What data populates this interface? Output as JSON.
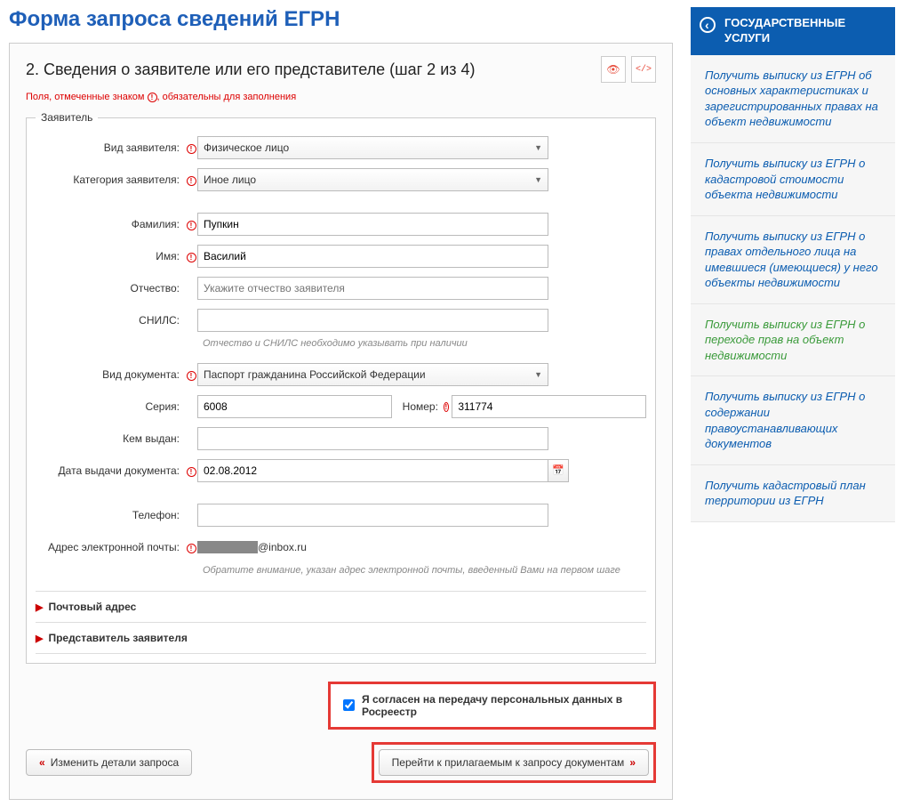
{
  "page_title": "Форма запроса сведений ЕГРН",
  "step_title": "2. Сведения о заявителе или его представителе (шаг 2 из 4)",
  "required_note_pre": "Поля, отмеченные знаком",
  "required_note_post": ", обязательны для заполнения",
  "fieldset_legend": "Заявитель",
  "labels": {
    "applicant_type": "Вид заявителя:",
    "applicant_category": "Категория заявителя:",
    "surname": "Фамилия:",
    "name": "Имя:",
    "patronymic": "Отчество:",
    "snils": "СНИЛС:",
    "doc_type": "Вид документа:",
    "series": "Серия:",
    "number": "Номер:",
    "issued_by": "Кем выдан:",
    "issue_date": "Дата выдачи документа:",
    "phone": "Телефон:",
    "email": "Адрес электронной почты:"
  },
  "values": {
    "applicant_type": "Физическое лицо",
    "applicant_category": "Иное лицо",
    "surname": "Пупкин",
    "name": "Василий",
    "patronymic": "",
    "patronymic_placeholder": "Укажите отчество заявителя",
    "snils": "",
    "doc_type": "Паспорт гражданина Российской Федерации",
    "series": "6008",
    "number": "311774",
    "issued_by": "",
    "issue_date": "02.08.2012",
    "phone": "",
    "email_suffix": "@inbox.ru"
  },
  "hints": {
    "patronymic_snils": "Отчество и СНИЛС необходимо указывать при наличии",
    "email": "Обратите внимание, указан адрес электронной почты, введенный Вами на первом шаге"
  },
  "sections": {
    "postal": "Почтовый адрес",
    "representative": "Представитель заявителя"
  },
  "consent_label": "Я согласен на передачу персональных данных в Росреестр",
  "buttons": {
    "back": "Изменить детали запроса",
    "next": "Перейти к прилагаемым к запросу документам"
  },
  "sidebar": {
    "header": "ГОСУДАРСТВЕННЫЕ УСЛУГИ",
    "items": [
      {
        "label": "Получить выписку из ЕГРН об основных характеристиках и зарегистрированных правах на объект недвижимости",
        "active": false
      },
      {
        "label": "Получить выписку из ЕГРН о кадастровой стоимости объекта недвижимости",
        "active": false
      },
      {
        "label": "Получить выписку из ЕГРН о правах отдельного лица на имевшиеся (имеющиеся) у него объекты недвижимости",
        "active": false
      },
      {
        "label": "Получить выписку из ЕГРН о переходе прав на объект недвижимости",
        "active": true
      },
      {
        "label": "Получить выписку из ЕГРН о содержании правоустанавливающих документов",
        "active": false
      },
      {
        "label": "Получить кадастровый план территории из ЕГРН",
        "active": false
      }
    ]
  }
}
